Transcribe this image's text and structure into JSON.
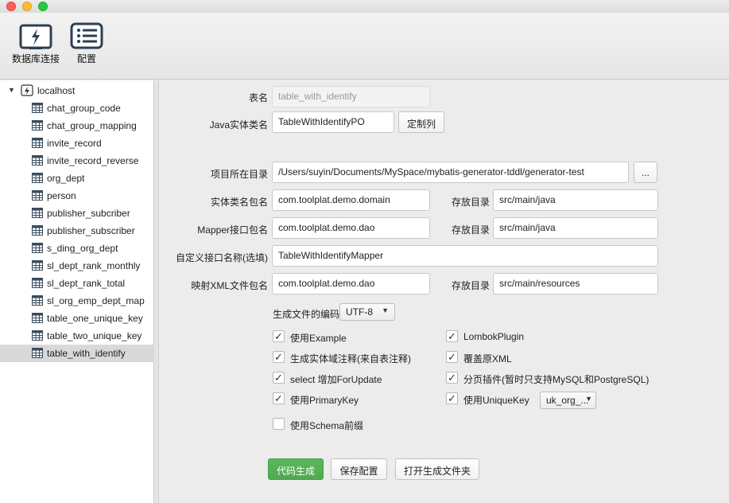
{
  "toolbar": {
    "db_connect_label": "数据库连接",
    "config_label": "配置"
  },
  "tree": {
    "root": "localhost",
    "tables": [
      "chat_group_code",
      "chat_group_mapping",
      "invite_record",
      "invite_record_reverse",
      "org_dept",
      "person",
      "publisher_subcriber",
      "publisher_subscriber",
      "s_ding_org_dept",
      "sl_dept_rank_monthly",
      "sl_dept_rank_total",
      "sl_org_emp_dept_map",
      "table_one_unique_key",
      "table_two_unique_key",
      "table_with_identify"
    ],
    "selected": "table_with_identify"
  },
  "form": {
    "table_name_label": "表名",
    "table_name_value": "table_with_identify",
    "entity_name_label": "Java实体类名",
    "entity_name_value": "TableWithIdentifyPO",
    "customize_columns_button": "定制列",
    "project_dir_label": "项目所在目录",
    "project_dir_value": "/Users/suyin/Documents/MySpace/mybatis-generator-tddl/generator-test",
    "browse_button": "...",
    "entity_package_label": "实体类名包名",
    "entity_package_value": "com.toolplat.demo.domain",
    "entity_dir_label": "存放目录",
    "entity_dir_value": "src/main/java",
    "mapper_package_label": "Mapper接口包名",
    "mapper_package_value": "com.toolplat.demo.dao",
    "mapper_dir_label": "存放目录",
    "mapper_dir_value": "src/main/java",
    "custom_interface_label": "自定义接口名称(选填)",
    "custom_interface_value": "TableWithIdentifyMapper",
    "xml_package_label": "映射XML文件包名",
    "xml_package_value": "com.toolplat.demo.dao",
    "xml_dir_label": "存放目录",
    "xml_dir_value": "src/main/resources",
    "encoding_label": "生成文件的编码",
    "encoding_value": "UTF-8"
  },
  "options": {
    "use_example": {
      "label": "使用Example",
      "checked": true
    },
    "lombok_plugin": {
      "label": "LombokPlugin",
      "checked": true
    },
    "entity_comment": {
      "label": "生成实体域注释(来自表注释)",
      "checked": true
    },
    "overwrite_xml": {
      "label": "覆盖原XML",
      "checked": true
    },
    "select_for_update": {
      "label": "select 增加ForUpdate",
      "checked": true
    },
    "pagination_plugin": {
      "label": "分页插件(暂时只支持MySQL和PostgreSQL)",
      "checked": true
    },
    "use_primary_key": {
      "label": "使用PrimaryKey",
      "checked": true
    },
    "use_unique_key": {
      "label": "使用UniqueKey",
      "checked": true
    },
    "unique_key_select": "uk_org_...",
    "schema_prefix": {
      "label": "使用Schema前缀",
      "checked": false
    }
  },
  "actions": {
    "generate_button": "代码生成",
    "save_config_button": "保存配置",
    "open_folder_button": "打开生成文件夹"
  },
  "colors": {
    "primary_button": "#5cb85c",
    "selection": "#d9d9d9"
  }
}
